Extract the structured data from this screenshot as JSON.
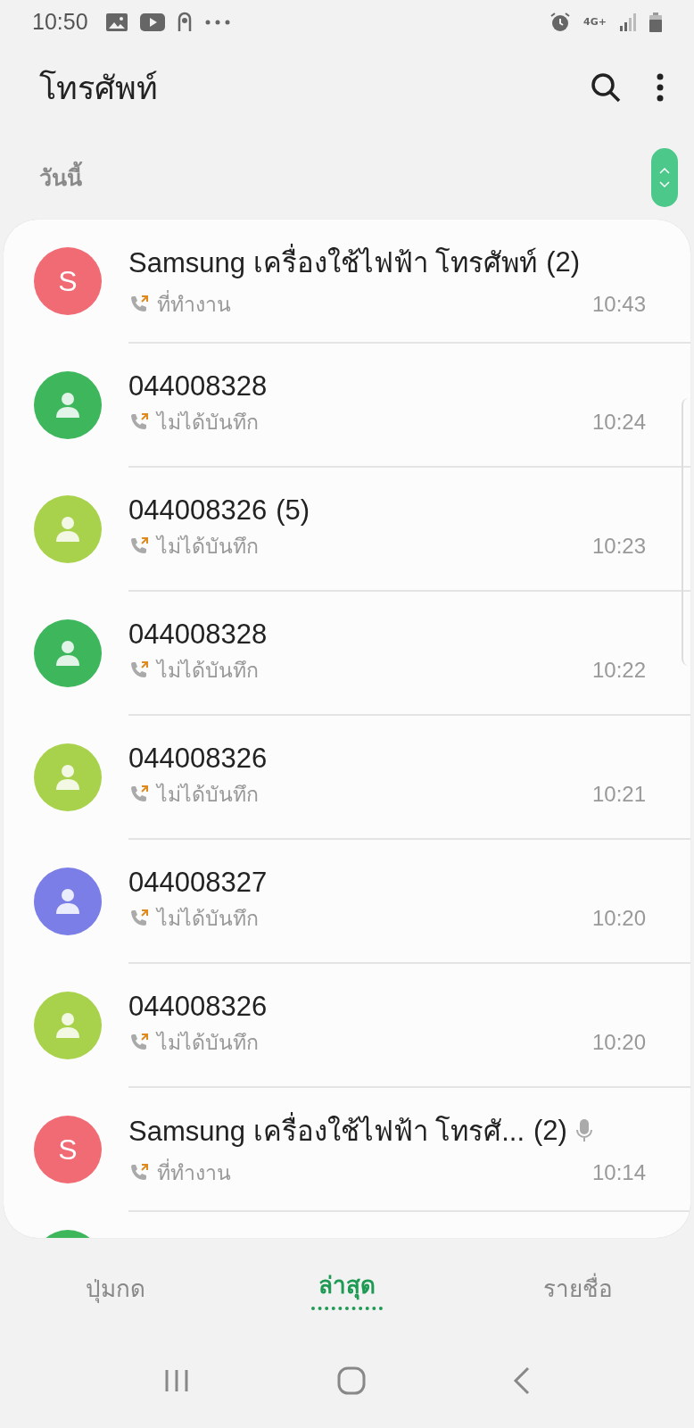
{
  "status_bar": {
    "time": "10:50",
    "network": "4G+"
  },
  "header": {
    "title": "โทรศัพท์"
  },
  "section": {
    "label": "วันนี้"
  },
  "calls": [
    {
      "kind": "letter",
      "initial": "S",
      "color": "#f06b73",
      "name": "Samsung เครื่องใช้ไฟฟ้า โทรศัพท์",
      "count": "(2)",
      "label": "ที่ทำงาน",
      "time": "10:43",
      "recording": false
    },
    {
      "kind": "person",
      "color": "#3db65c",
      "name": "044008328",
      "label": "ไม่ได้บันทึก",
      "time": "10:24",
      "recording": false
    },
    {
      "kind": "person",
      "color": "#a9d24c",
      "name": "044008326",
      "count": "(5)",
      "label": "ไม่ได้บันทึก",
      "time": "10:23",
      "recording": false
    },
    {
      "kind": "person",
      "color": "#3db65c",
      "name": "044008328",
      "label": "ไม่ได้บันทึก",
      "time": "10:22",
      "recording": false
    },
    {
      "kind": "person",
      "color": "#a9d24c",
      "name": "044008326",
      "label": "ไม่ได้บันทึก",
      "time": "10:21",
      "recording": false
    },
    {
      "kind": "person",
      "color": "#7b7ee6",
      "name": "044008327",
      "label": "ไม่ได้บันทึก",
      "time": "10:20",
      "recording": false
    },
    {
      "kind": "person",
      "color": "#a9d24c",
      "name": "044008326",
      "label": "ไม่ได้บันทึก",
      "time": "10:20",
      "recording": false
    },
    {
      "kind": "letter",
      "initial": "S",
      "color": "#f06b73",
      "name": "Samsung เครื่องใช้ไฟฟ้า โทรศั...",
      "count": "(2)",
      "label": "ที่ทำงาน",
      "time": "10:14",
      "recording": true
    },
    {
      "kind": "partial",
      "color": "#3db65c"
    }
  ],
  "tabs": [
    {
      "label": "ปุ่มกด",
      "selected": false
    },
    {
      "label": "ล่าสุด",
      "selected": true
    },
    {
      "label": "รายชื่อ",
      "selected": false
    }
  ]
}
